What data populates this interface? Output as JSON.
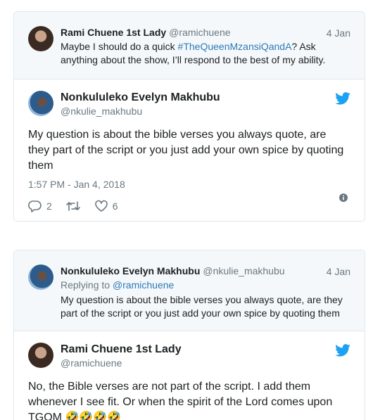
{
  "thread1": {
    "parent": {
      "name": "Rami Chuene 1st Lady",
      "handle": "@ramichuene",
      "date": "4 Jan",
      "text_before": "Maybe I should do a quick ",
      "hashtag": "#TheQueenMzansiQandA",
      "text_after": "? Ask anything about the show, I’ll respond to the best of my ability."
    },
    "main": {
      "name": "Nonkululeko Evelyn Makhubu",
      "handle": "@nkulie_makhubu",
      "text": "My question is about the bible verses you always quote, are they part of the script or you just add your own spice by quoting them",
      "timestamp": "1:57 PM - Jan 4, 2018",
      "replies": "2",
      "likes": "6"
    }
  },
  "thread2": {
    "parent": {
      "name": "Nonkululeko Evelyn Makhubu",
      "handle": "@nkulie_makhubu",
      "date": "4 Jan",
      "replying_prefix": "Replying to ",
      "replying_to": "@ramichuene",
      "text": "My question is about the bible verses you always quote, are they part of the script or you just add your own spice by quoting them"
    },
    "main": {
      "name": "Rami Chuene 1st Lady",
      "handle": "@ramichuene",
      "text": "No, the Bible verses are not part of the script. I add them whenever I see fit. Or when the spirit of the Lord comes upon TGOM 🤣🤣🤣🤣"
    }
  },
  "colors": {
    "twitter_blue": "#1da1f2",
    "link": "#2b7bb9",
    "muted": "#697882"
  },
  "icons": [
    "reply-icon",
    "retweet-icon",
    "like-icon",
    "info-icon",
    "twitter-bird-icon"
  ]
}
